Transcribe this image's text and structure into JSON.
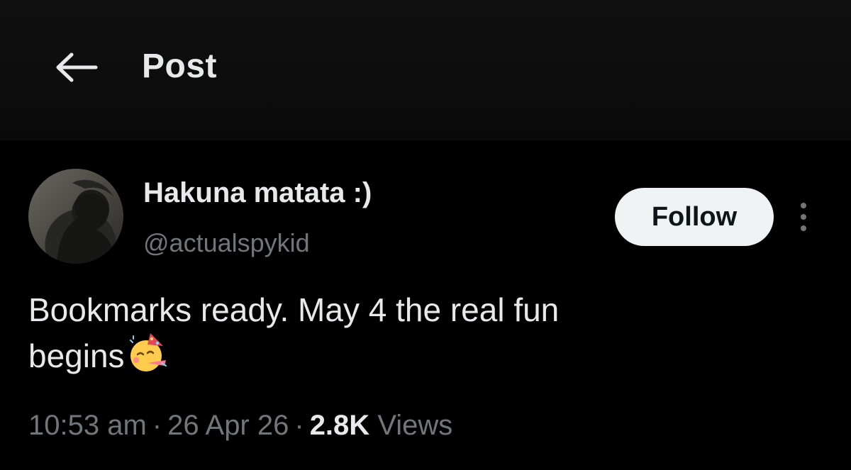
{
  "header": {
    "title": "Post",
    "back_icon": "arrow-left-icon"
  },
  "post": {
    "author": {
      "display_name": "Hakuna matata :)",
      "handle": "@actualspykid",
      "avatar": "avatar-photo"
    },
    "follow_label": "Follow",
    "more_icon": "more-vertical-icon",
    "text_line1": "Bookmarks ready. May 4 the real fun",
    "text_line2": "begins",
    "emoji": "partying-face-emoji",
    "meta": {
      "time": "10:53 am",
      "date": "26 Apr 26",
      "views_count": "2.8K",
      "views_label": "Views",
      "separator": "·"
    }
  },
  "colors": {
    "background": "#000000",
    "text_primary": "#e7e9ea",
    "text_secondary": "#71767b",
    "follow_bg": "#eff3f4",
    "follow_text": "#0f1419"
  }
}
